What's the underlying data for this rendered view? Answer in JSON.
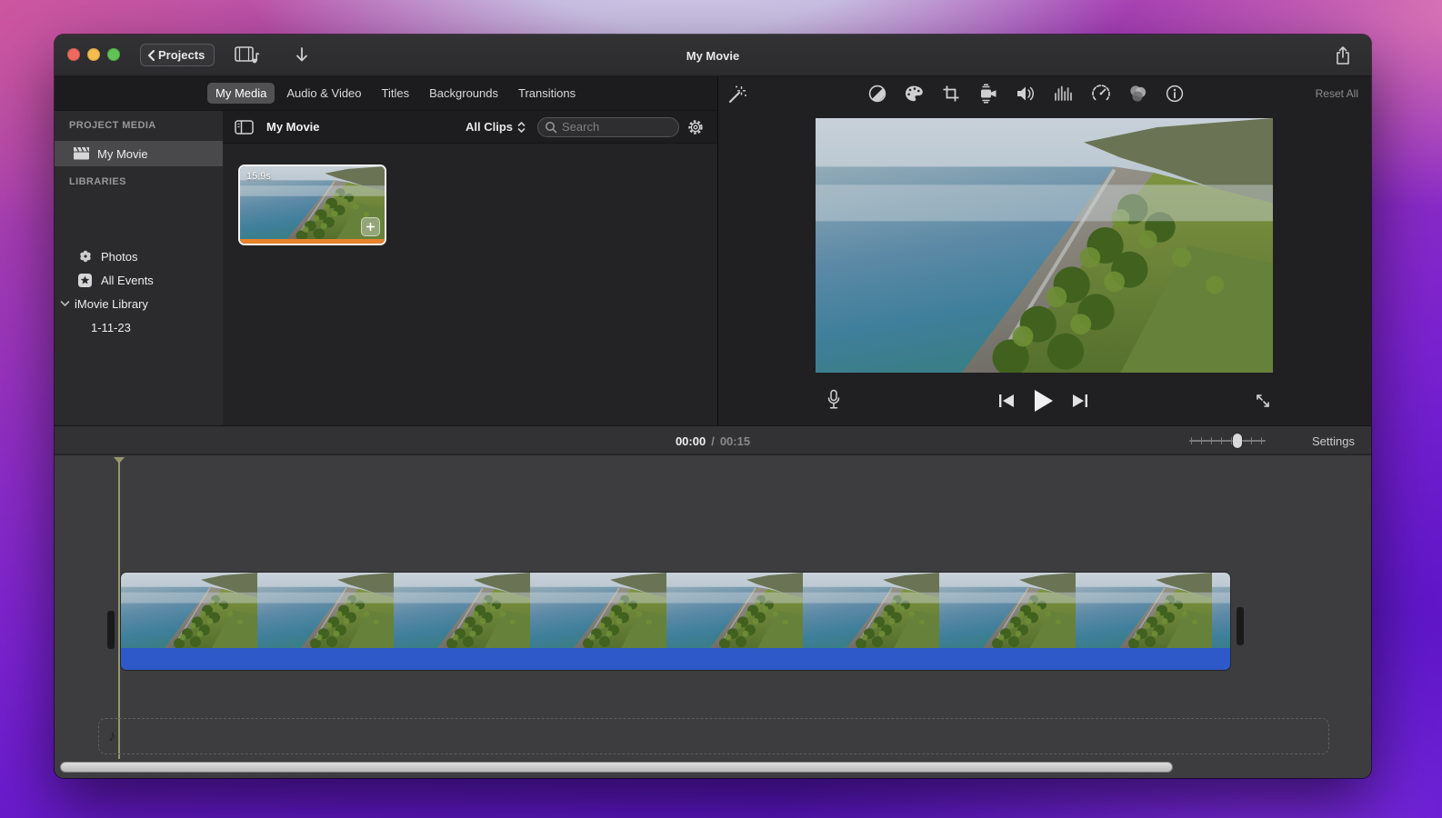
{
  "titlebar": {
    "back": "Projects",
    "title": "My Movie"
  },
  "tabs": {
    "my_media": "My Media",
    "audio_video": "Audio & Video",
    "titles": "Titles",
    "backgrounds": "Backgrounds",
    "transitions": "Transitions"
  },
  "sidebar": {
    "project_media": "PROJECT MEDIA",
    "my_movie": "My Movie",
    "libraries": "LIBRARIES",
    "photos": "Photos",
    "all_events": "All Events",
    "imovie_library": "iMovie Library",
    "event_1": "1-11-23"
  },
  "browser": {
    "title": "My Movie",
    "filter": "All Clips",
    "search_placeholder": "Search",
    "clip_duration": "15.9s"
  },
  "viewer": {
    "reset_all": "Reset All"
  },
  "timeline": {
    "current": "00:00",
    "sep": "/",
    "total": "00:15",
    "settings": "Settings",
    "music_note": "♪"
  },
  "colors": {
    "audio_bar_blue": "#2d59c9",
    "clip_used_orange": "#e8832c",
    "playhead_olive": "#97976d",
    "selection_white": "#f4f4f4"
  }
}
